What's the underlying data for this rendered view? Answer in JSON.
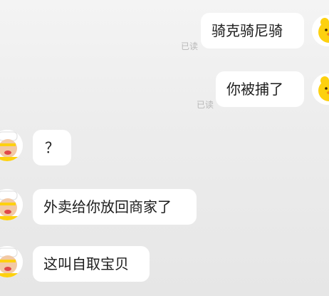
{
  "chat": {
    "messages": [
      {
        "side": "right",
        "text": "骑克骑尼骑",
        "status": "已读",
        "avatar_icon": "yellow-duck-icon"
      },
      {
        "side": "right",
        "text": "你被捕了",
        "status": "已读",
        "avatar_icon": "yellow-duck-icon"
      },
      {
        "side": "left",
        "text": "？",
        "avatar_icon": "cartoon-chef-icon"
      },
      {
        "side": "left",
        "text": "外卖给你放回商家了",
        "avatar_icon": "cartoon-chef-icon"
      },
      {
        "side": "left",
        "text": "这叫自取宝贝",
        "avatar_icon": "cartoon-chef-icon"
      }
    ]
  },
  "colors": {
    "background": "#ededed",
    "bubble": "#ffffff",
    "text": "#1c1c1c",
    "read_status": "#b8b8b8",
    "duck_yellow": "#fdd10f",
    "chef_skin": "#f2c9a5"
  }
}
